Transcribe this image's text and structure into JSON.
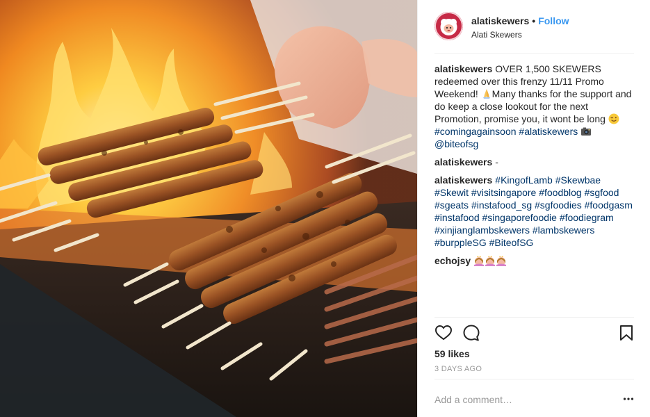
{
  "photo": {
    "icon": "food-photo",
    "subject": "lamb-skewers-on-grill"
  },
  "header": {
    "username": "alatiskewers",
    "separator": "•",
    "follow_label": "Follow",
    "location": "Alati Skewers"
  },
  "caption": {
    "user": "alatiskewers",
    "text_1": "OVER 1,500 SKEWERS redeemed over this frenzy 11/11 Promo Weekend! ",
    "text_2": "Many thanks for the support and do keep a close lookout for the next Promotion, promise you, it wont be long ",
    "tag_1": "#comingagainsoon",
    "tag_2": "#alatiskewers",
    "mention": "@biteofsg"
  },
  "comments": [
    {
      "user": "alatiskewers",
      "text": "-"
    },
    {
      "user": "alatiskewers",
      "tags": [
        "#KingofLamb",
        "#Skewbae",
        "#Skewit",
        "#visitsingapore",
        "#foodblog",
        "#sgfood",
        "#sgeats",
        "#instafood_sg",
        "#sgfoodies",
        "#foodgasm",
        "#instafood",
        "#singaporefoodie",
        "#foodiegram",
        "#xinjianglambskewers",
        "#lambskewers",
        "#burppleSG",
        "#BiteofSG"
      ]
    },
    {
      "user": "echojsy",
      "emoji_count": 3
    }
  ],
  "actions": {
    "like_icon": "heart-icon",
    "comment_icon": "comment-icon",
    "save_icon": "bookmark-icon"
  },
  "likes": "59 likes",
  "time_ago": "3 DAYS AGO",
  "comment_input": {
    "placeholder": "Add a comment…"
  },
  "colors": {
    "accent": "#3897f0",
    "hashtag": "#003569",
    "muted": "#999999",
    "text": "#262626",
    "divider": "#efefef"
  }
}
